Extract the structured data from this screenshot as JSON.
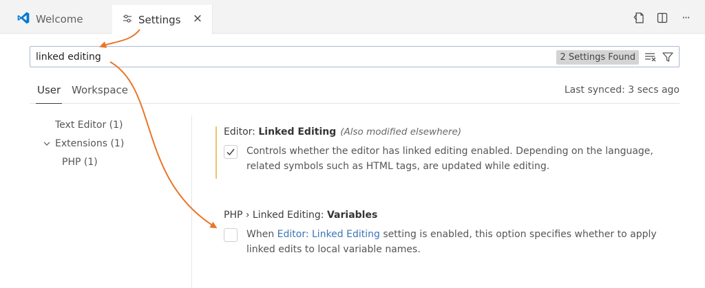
{
  "tabs": {
    "welcome_label": "Welcome",
    "settings_label": "Settings",
    "close_glyph": "×",
    "more_glyph": "···"
  },
  "search": {
    "value": "linked editing",
    "badge": "2 Settings Found"
  },
  "scope": {
    "user": "User",
    "workspace": "Workspace",
    "last_synced": "Last synced: 3 secs ago"
  },
  "toc": {
    "text_editor": "Text Editor (1)",
    "extensions": "Extensions (1)",
    "php": "PHP (1)"
  },
  "settings": [
    {
      "category": "Editor: ",
      "name": "Linked Editing",
      "modified_note": "(Also modified elsewhere)",
      "checked": true,
      "description": "Controls whether the editor has linked editing enabled. Depending on the language, related symbols such as HTML tags, are updated while editing."
    },
    {
      "category": "PHP › Linked Editing: ",
      "name": "Variables",
      "checked": false,
      "desc_prefix": "When ",
      "desc_link": "Editor: Linked Editing",
      "desc_suffix": " setting is enabled, this option specifies whether to apply linked edits to local variable names."
    }
  ],
  "colors": {
    "brand_blue": "#0078d4",
    "annotation_orange": "#e8752a",
    "modified_bar": "#e9c46a",
    "link": "#3a74b8"
  }
}
